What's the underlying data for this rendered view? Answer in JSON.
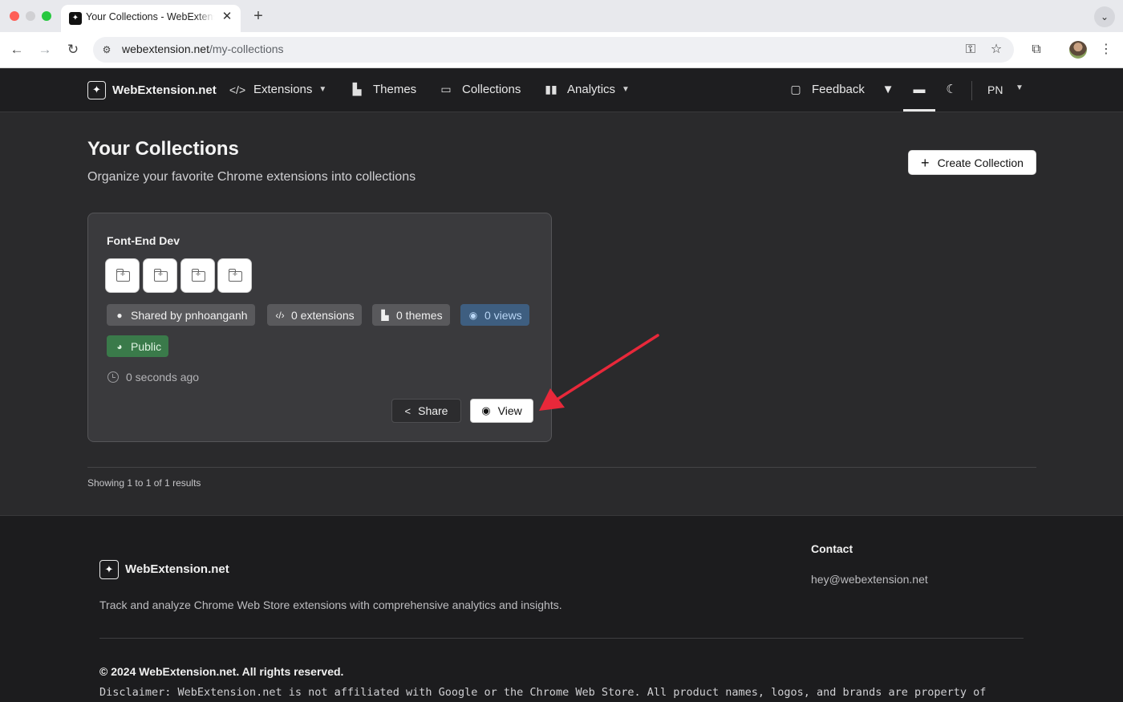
{
  "browser": {
    "tab_title": "Your Collections - WebExtension.net",
    "tab_close": "✕",
    "new_tab": "+",
    "url_host": "webextension.net",
    "url_path": "/my-collections"
  },
  "nav": {
    "brand": "WebExtension.net",
    "items": [
      {
        "label": "Extensions",
        "icon": "code-icon"
      },
      {
        "label": "Themes",
        "icon": "palette-icon"
      },
      {
        "label": "Collections",
        "icon": "folder-icon"
      },
      {
        "label": "Analytics",
        "icon": "bar-chart-icon"
      }
    ],
    "feedback": "Feedback",
    "user_initials": "PN"
  },
  "header": {
    "title": "Your Collections",
    "subtitle": "Organize your favorite Chrome extensions into collections",
    "create_button": "Create Collection"
  },
  "collection": {
    "name": "Font-End Dev",
    "shared_by": "Shared by pnhoanganh",
    "extensions": "0 extensions",
    "themes": "0 themes",
    "views": "0 views",
    "visibility": "Public",
    "updated": "0 seconds ago",
    "share_label": "Share",
    "view_label": "View"
  },
  "pagination": {
    "results_text": "Showing 1 to 1 of 1 results"
  },
  "footer": {
    "brand": "WebExtension.net",
    "description": "Track and analyze Chrome Web Store extensions with comprehensive analytics and insights.",
    "contact_heading": "Contact",
    "email": "hey@webextension.net",
    "copyright": "© 2024 WebExtension.net. All rights reserved.",
    "disclaimer": "Disclaimer: WebExtension.net is not affiliated with Google or the Chrome Web Store. All product names, logos, and brands are property of"
  },
  "colors": {
    "page_bg": "#2a2a2c",
    "nav_bg": "#1e1e20",
    "card_bg": "#3a3a3d",
    "views_badge": "#3e5e80",
    "public_badge": "#3a7a4a",
    "arrow": "#e8283a"
  }
}
